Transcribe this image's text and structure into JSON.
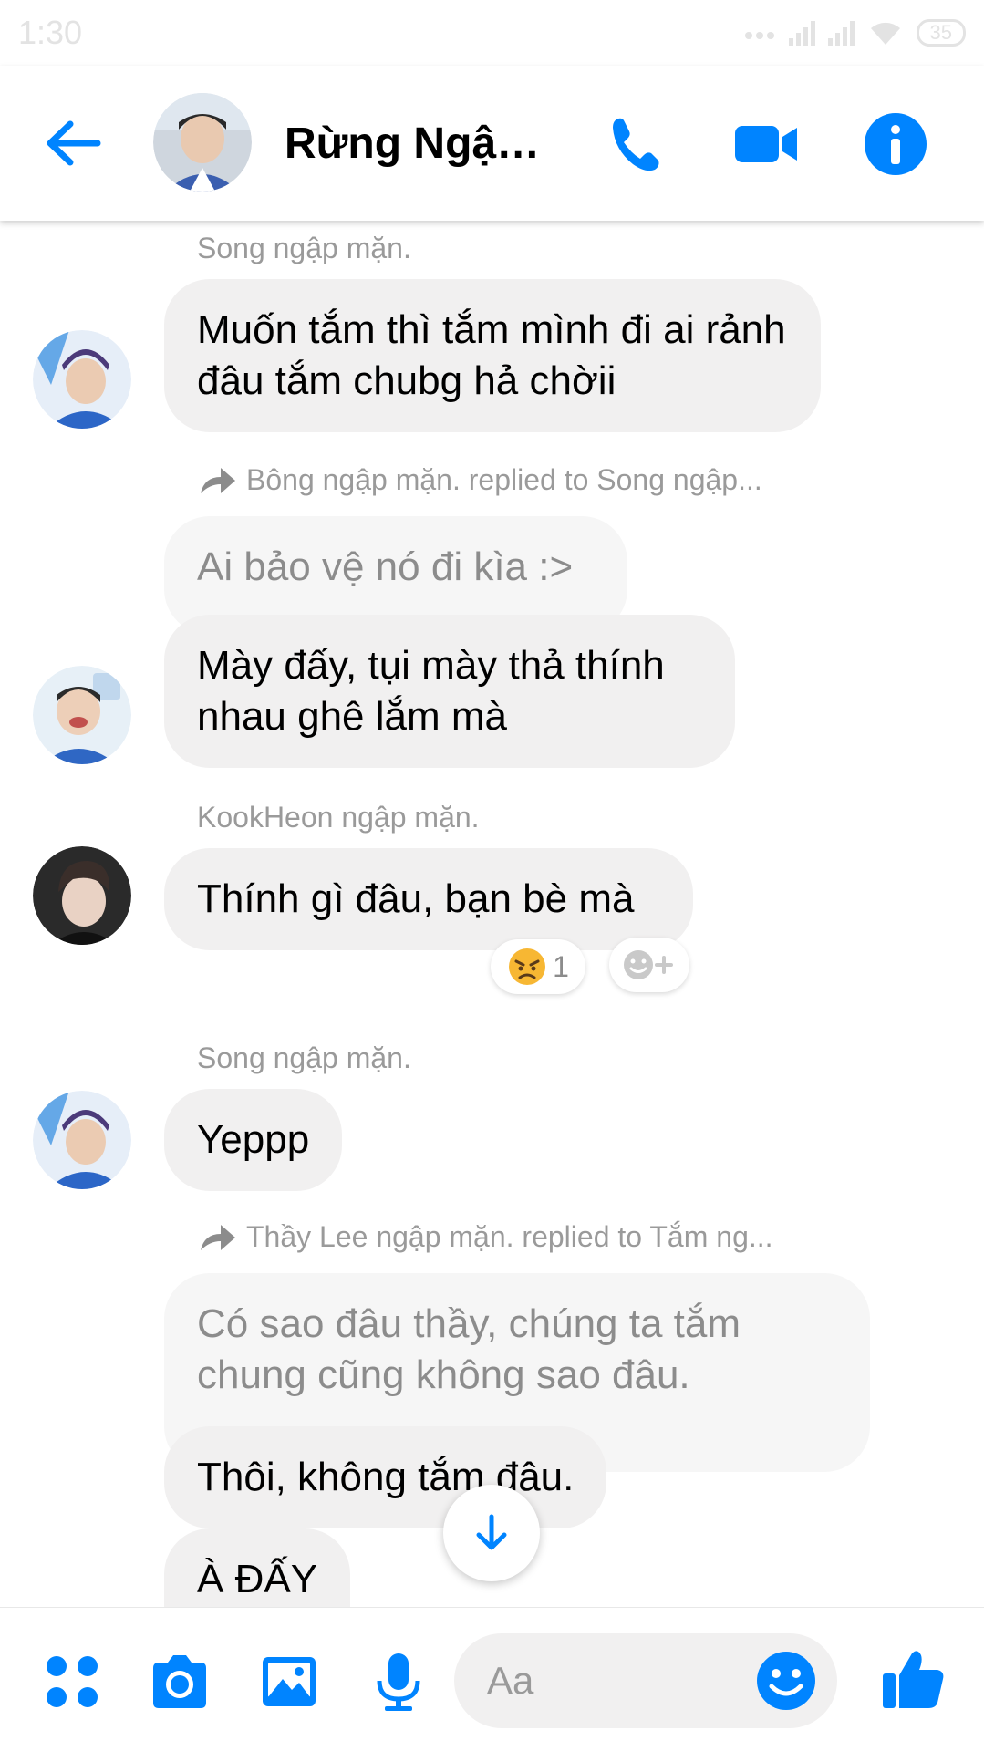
{
  "status_bar": {
    "time": "1:30",
    "battery": "35"
  },
  "header": {
    "title": "Rừng Ngập..."
  },
  "messages": {
    "m1_sender": "Song ngập mặn.",
    "m1_text": "Muốn tắm thì tắm mình đi ai rảnh đâu tắm chubg hả chờii",
    "m2_reply_label": "Bông ngập mặn. replied to Song ngập...",
    "m2_quote": "Ai bảo vệ nó đi kìa :>",
    "m2_text": "Mày đấy, tụi mày thả thính nhau ghê lắm mà",
    "m3_sender": "KookHeon ngập mặn.",
    "m3_text": "Thính gì đâu, bạn bè mà",
    "m3_reaction_count": "1",
    "m4_sender": "Song ngập mặn.",
    "m4_text": "Yeppp",
    "m5_reply_label": "Thầy Lee ngập mặn. replied to Tắm ng...",
    "m5_quote": "Có sao đâu thầy, chúng ta tắm chung cũng không sao đâu.",
    "m5_text": "Thôi, không tắm đâu.",
    "m6_text": "À ĐẤY"
  },
  "composer": {
    "placeholder": "Aa"
  },
  "colors": {
    "accent": "#0084ff",
    "bubble": "#f1f0f0",
    "meta_text": "#9a9a9a"
  },
  "icons": [
    "back-arrow-icon",
    "phone-icon",
    "video-camera-icon",
    "info-icon",
    "reply-arrow-icon",
    "angry-face-icon",
    "add-reaction-icon",
    "arrow-down-icon",
    "apps-grid-icon",
    "camera-icon",
    "gallery-icon",
    "microphone-icon",
    "emoji-icon",
    "thumbs-up-icon"
  ]
}
